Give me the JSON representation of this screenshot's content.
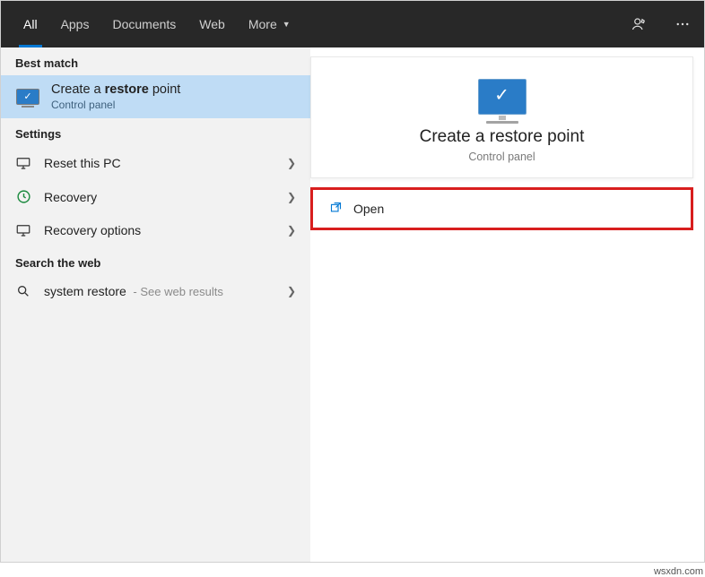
{
  "tabs": {
    "all": "All",
    "apps": "Apps",
    "documents": "Documents",
    "web": "Web",
    "more": "More"
  },
  "sections": {
    "bestMatch": "Best match",
    "settings": "Settings",
    "searchWeb": "Search the web"
  },
  "bestMatch": {
    "titlePre": "Create a ",
    "titleHighlight": "restore",
    "titlePost": " point",
    "subtitle": "Control panel"
  },
  "settingsItems": {
    "resetPc": "Reset this PC",
    "recovery": "Recovery",
    "recoveryOptions": "Recovery options"
  },
  "webSearch": {
    "query": "system restore",
    "hint": " - See web results"
  },
  "preview": {
    "title": "Create a restore point",
    "subtitle": "Control panel"
  },
  "actions": {
    "open": "Open"
  },
  "watermark": "wsxdn.com"
}
